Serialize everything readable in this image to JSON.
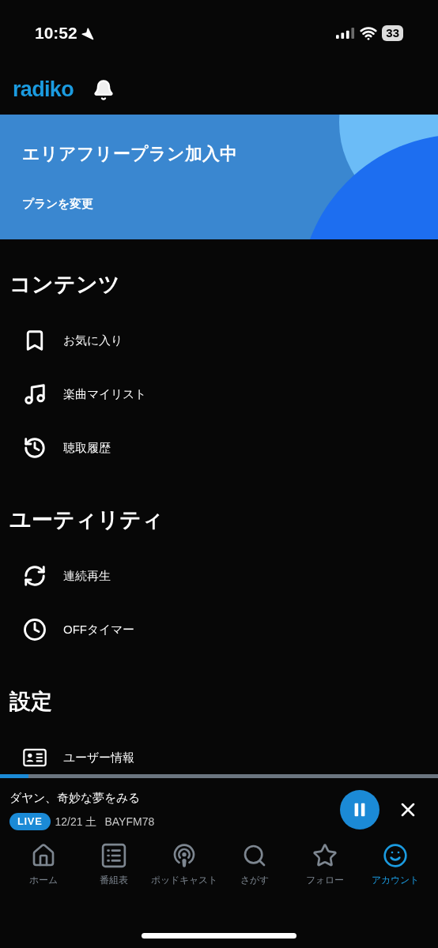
{
  "status_bar": {
    "time": "10:52",
    "battery": "33"
  },
  "header": {
    "logo": "radiko"
  },
  "banner": {
    "title": "エリアフリープラン加入中",
    "link": "プランを変更"
  },
  "sections": [
    {
      "title": "コンテンツ",
      "items": [
        {
          "label": "お気に入り"
        },
        {
          "label": "楽曲マイリスト"
        },
        {
          "label": "聴取履歴"
        }
      ]
    },
    {
      "title": "ユーティリティ",
      "items": [
        {
          "label": "連続再生"
        },
        {
          "label": "OFFタイマー"
        }
      ]
    },
    {
      "title": "設定",
      "items": [
        {
          "label": "ユーザー情報"
        }
      ]
    }
  ],
  "player": {
    "level": 0.065,
    "title": "ダヤン、奇妙な夢をみる",
    "badge": "LIVE",
    "date": "12/21 土",
    "station": "BAYFM78",
    "playing": true
  },
  "tabs": [
    {
      "label": "ホーム",
      "selected": false
    },
    {
      "label": "番組表",
      "selected": false
    },
    {
      "label": "ポッドキャスト",
      "selected": false
    },
    {
      "label": "さがす",
      "selected": false
    },
    {
      "label": "フォロー",
      "selected": false
    },
    {
      "label": "アカウント",
      "selected": true
    }
  ]
}
